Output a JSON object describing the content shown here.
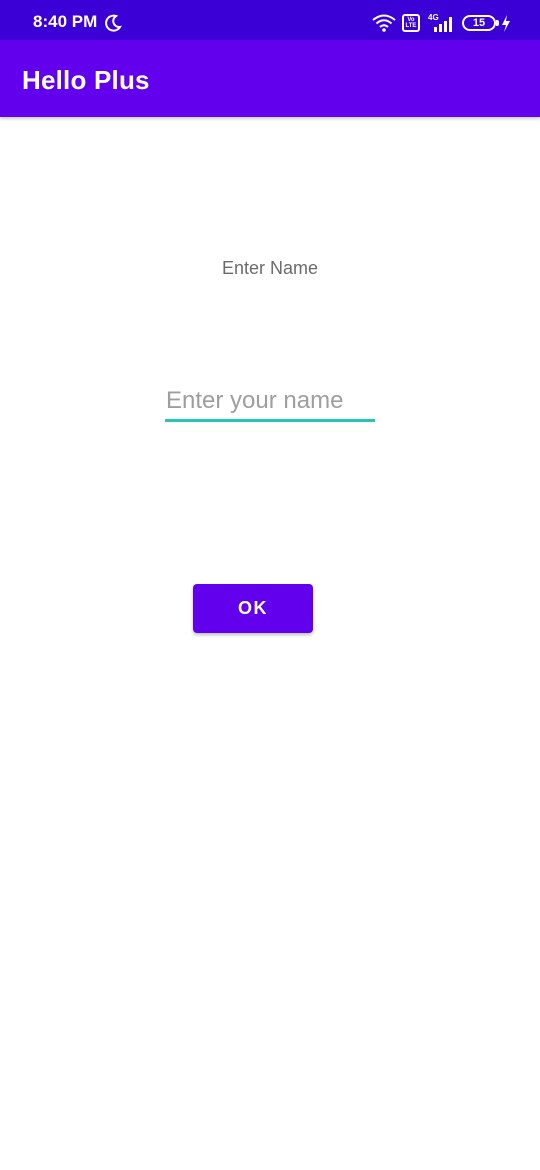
{
  "status_bar": {
    "time": "8:40 PM",
    "network_type": "4G",
    "volte_label": "Vo LTE",
    "battery_percent": "15",
    "battery_level": 0.15,
    "icons": [
      "moon-icon",
      "wifi-icon",
      "volte-icon",
      "signal-icon",
      "battery-icon",
      "charging-bolt-icon"
    ]
  },
  "app_bar": {
    "title": "Hello Plus"
  },
  "main": {
    "label": "Enter Name",
    "input_placeholder": "Enter your name",
    "input_value": "",
    "ok_button": "OK"
  },
  "colors": {
    "status_bar_bg": "#3a00d6",
    "primary": "#6200ee",
    "input_accent": "#26c6b4",
    "label_text": "#6b6b6b"
  }
}
